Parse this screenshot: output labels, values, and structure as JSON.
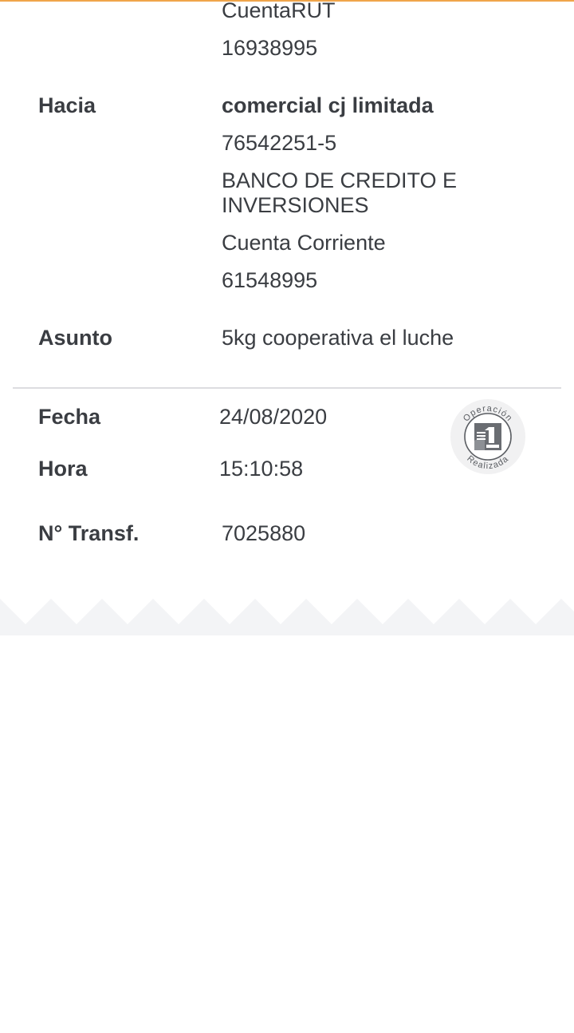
{
  "origin": {
    "account_type": "CuentaRUT",
    "account_number": "16938995"
  },
  "destination": {
    "label": "Hacia",
    "name": "comercial cj limitada",
    "rut": "76542251-5",
    "bank": "BANCO DE CREDITO E INVERSIONES",
    "account_type": "Cuenta Corriente",
    "account_number": "61548995"
  },
  "subject": {
    "label": "Asunto",
    "value": "5kg cooperativa el luche"
  },
  "date": {
    "label": "Fecha",
    "value": "24/08/2020"
  },
  "time": {
    "label": "Hora",
    "value": "15:10:58"
  },
  "transfer": {
    "label": "N° Transf.",
    "value": "7025880"
  },
  "stamp": {
    "top_text": "Operación",
    "bottom_text": "Realizada",
    "icon": "bank-logo-icon"
  },
  "colors": {
    "accent": "#f0a54a",
    "text": "#3a3d42",
    "divider": "#dcdde0",
    "footer": "#f3f4f6"
  }
}
